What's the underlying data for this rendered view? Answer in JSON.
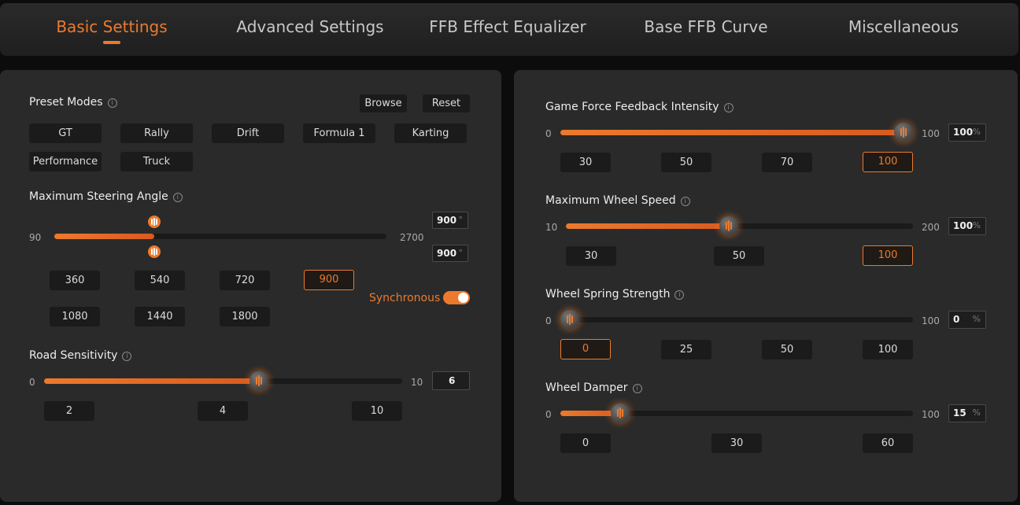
{
  "tabs": [
    "Basic Settings",
    "Advanced Settings",
    "FFB Effect Equalizer",
    "Base FFB Curve",
    "Miscellaneous"
  ],
  "active_tab": "Basic Settings",
  "accent_color": "#ec7a2c",
  "left": {
    "preset": {
      "title": "Preset Modes",
      "browse": "Browse",
      "reset": "Reset",
      "modes": [
        "GT",
        "Rally",
        "Drift",
        "Formula 1",
        "Karting",
        "Performance",
        "Truck"
      ]
    },
    "steering": {
      "title": "Maximum Steering Angle",
      "min": "90",
      "max": "2700",
      "value_fraction": 0.3,
      "value_top": "900",
      "value_bottom": "900",
      "unit": "°",
      "options": [
        "360",
        "540",
        "720",
        "900",
        "1080",
        "1440",
        "1800"
      ],
      "selected": "900",
      "sync_label": "Synchronous",
      "sync_on": true
    },
    "road": {
      "title": "Road Sensitivity",
      "min": "0",
      "max": "10",
      "value": "6",
      "value_fraction": 0.6,
      "options": [
        "2",
        "4",
        "10"
      ]
    }
  },
  "right": {
    "ffb": {
      "title": "Game Force Feedback Intensity",
      "min": "0",
      "max": "100",
      "value": "100",
      "unit": "%",
      "value_fraction": 1.0,
      "options": [
        "30",
        "50",
        "70",
        "100"
      ],
      "selected": "100"
    },
    "wheel_speed": {
      "title": "Maximum Wheel Speed",
      "min": "10",
      "max": "200",
      "value": "100",
      "unit": "%",
      "value_fraction": 0.47,
      "options": [
        "30",
        "50",
        "100"
      ],
      "selected": "100"
    },
    "spring": {
      "title": "Wheel Spring Strength",
      "min": "0",
      "max": "100",
      "value": "0",
      "unit": "%",
      "value_fraction": 0.0,
      "options": [
        "0",
        "25",
        "50",
        "100"
      ],
      "selected": "0"
    },
    "damper": {
      "title": "Wheel Damper",
      "min": "0",
      "max": "100",
      "value": "15",
      "unit": "%",
      "value_fraction": 0.17,
      "options": [
        "0",
        "30",
        "60"
      ],
      "selected": null
    }
  }
}
